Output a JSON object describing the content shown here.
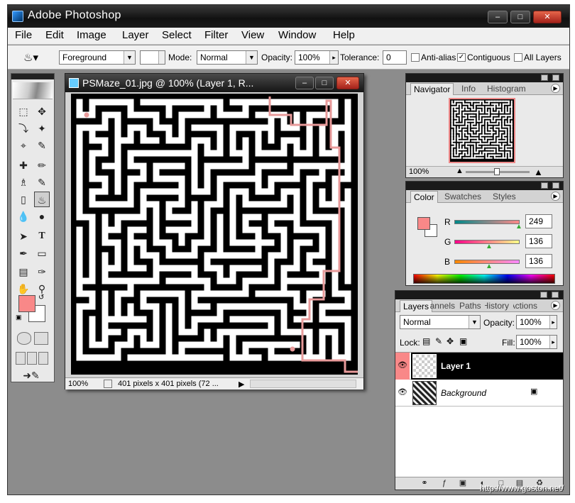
{
  "app": {
    "title": "Adobe Photoshop"
  },
  "menu": [
    "File",
    "Edit",
    "Image",
    "Layer",
    "Select",
    "Filter",
    "View",
    "Window",
    "Help"
  ],
  "options": {
    "fill_source": "Foreground",
    "mode_label": "Mode:",
    "mode_value": "Normal",
    "opacity_label": "Opacity:",
    "opacity_value": "100%",
    "tolerance_label": "Tolerance:",
    "tolerance_value": "0",
    "anti_alias_label": "Anti-alias",
    "anti_alias_checked": false,
    "contiguous_label": "Contiguous",
    "contiguous_checked": true,
    "all_layers_label": "All Layers",
    "all_layers_checked": false
  },
  "document": {
    "title": "PSMaze_01.jpg  @  100%  (Layer 1, R...",
    "zoom": "100%",
    "info": "401 pixels x 401 pixels (72 ..."
  },
  "navigator": {
    "tabs": [
      "Navigator",
      "Info",
      "Histogram"
    ],
    "zoom": "100%"
  },
  "color_panel": {
    "tabs": [
      "Color",
      "Swatches",
      "Styles"
    ],
    "channels": [
      {
        "label": "R",
        "value": "249"
      },
      {
        "label": "G",
        "value": "136"
      },
      {
        "label": "B",
        "value": "136"
      }
    ],
    "foreground_hex": "#f98888"
  },
  "layers_panel": {
    "tabs": [
      "Layers",
      "Channels",
      "Paths",
      "History",
      "Actions"
    ],
    "blend_mode": "Normal",
    "opacity_label": "Opacity:",
    "opacity_value": "100%",
    "lock_label": "Lock:",
    "fill_label": "Fill:",
    "fill_value": "100%",
    "layers": [
      {
        "name": "Layer 1",
        "selected": true
      },
      {
        "name": "Background",
        "selected": false
      }
    ]
  },
  "watermark": "http://www.goston.net/",
  "colors": {
    "accent_red": "#f98888",
    "path_stroke": "#e89a9a"
  }
}
